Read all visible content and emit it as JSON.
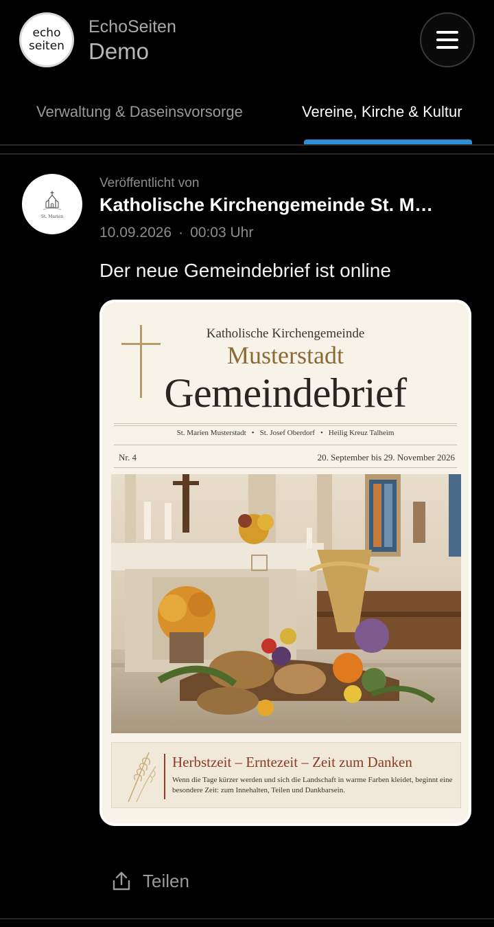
{
  "app": {
    "logo_line1": "echo",
    "logo_line2": "seiten",
    "name": "EchoSeiten",
    "subtitle": "Demo"
  },
  "tabs": [
    {
      "label": "Verwaltung & Daseinsvorsorge",
      "active": false
    },
    {
      "label": "Vereine, Kirche & Kultur",
      "active": true
    }
  ],
  "post": {
    "avatar_label": "St. Marien",
    "published_label": "Veröffentlicht von",
    "publisher": "Katholische Kirchengemeinde St. M…",
    "date": "10.09.2026",
    "separator": "·",
    "time": "00:03 Uhr",
    "title": "Der neue Gemeindebrief ist online"
  },
  "document": {
    "organization": "Katholische Kirchengemeinde",
    "town": "Musterstadt",
    "title": "Gemeindebrief",
    "parishes": [
      "St. Marien Musterstadt",
      "St. Josef Oberdorf",
      "Heilig Kreuz Talheim"
    ],
    "parish_separator": "•",
    "issue": "Nr. 4",
    "period": "20. September bis 29. November 2026",
    "feature_heading": "Herbstzeit – Erntezeit – Zeit zum Danken",
    "feature_text": "Wenn die Tage kürzer werden und sich die Landschaft in warme Farben kleidet, beginnt eine besondere Zeit: zum Innehalten, Teilen und Dankbarsein."
  },
  "actions": {
    "share_label": "Teilen"
  },
  "colors": {
    "background": "#000000",
    "tab_indicator": "#2f8fd6",
    "paper": "#f7f3e9",
    "accent_gold": "#8c6a36",
    "accent_red": "#8b3a24"
  }
}
